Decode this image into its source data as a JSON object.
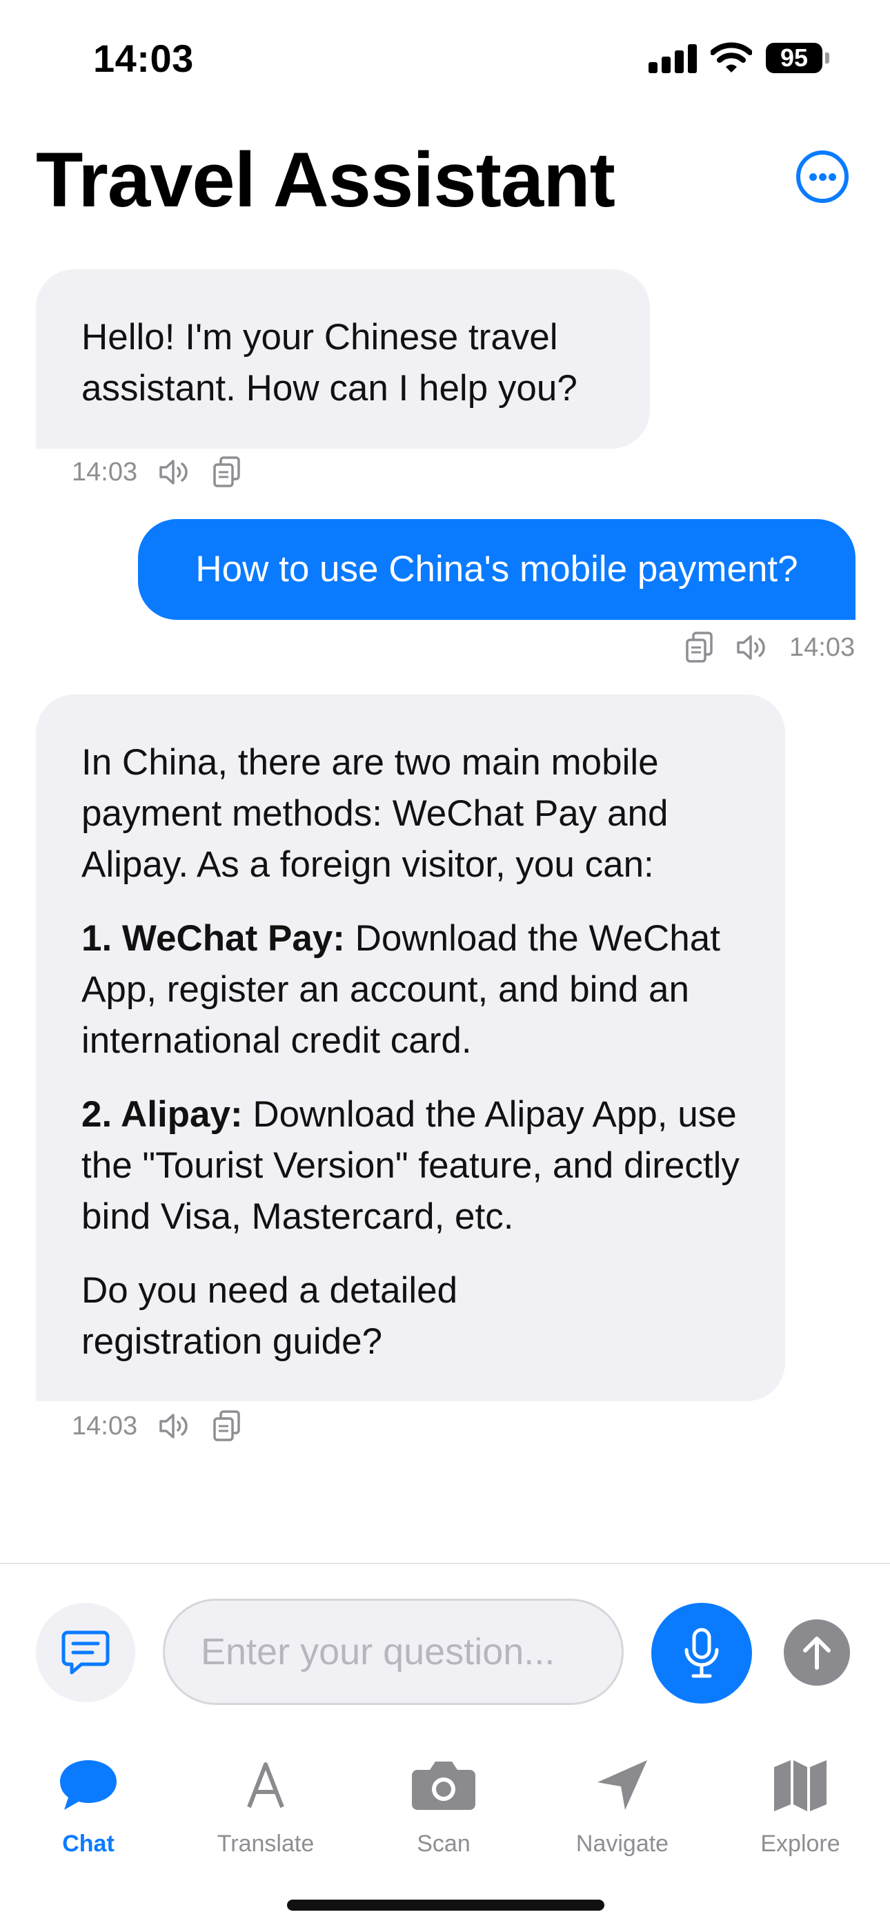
{
  "status_bar": {
    "time": "14:03",
    "battery": "95"
  },
  "header": {
    "title": "Travel Assistant",
    "more_icon": "ellipsis-circle-icon"
  },
  "messages": [
    {
      "role": "assistant",
      "paragraphs": [
        "Hello! I'm your Chinese travel assistant. How can I help you?"
      ],
      "time": "14:03"
    },
    {
      "role": "user",
      "text": "How to use China's mobile payment?",
      "time": "14:03"
    },
    {
      "role": "assistant",
      "intro": "In China, there are two main mobile payment methods: WeChat Pay and Alipay. As a foreign visitor, you can:",
      "items": [
        {
          "title": "1. WeChat Pay:",
          "text": "Download the WeChat App, register an account, and bind an international credit card."
        },
        {
          "title": "2. Alipay:",
          "text": "Download the Alipay App, use the \"Tourist Version\" feature, and directly bind Visa, Mastercard, etc."
        }
      ],
      "outro": "Do you need a detailed registration guide?",
      "time": "14:03"
    }
  ],
  "composer": {
    "placeholder": "Enter your question..."
  },
  "tabs": [
    {
      "label": "Chat",
      "icon": "chat-bubble-icon",
      "active": true
    },
    {
      "label": "Translate",
      "icon": "letter-a-icon",
      "active": false
    },
    {
      "label": "Scan",
      "icon": "camera-icon",
      "active": false
    },
    {
      "label": "Navigate",
      "icon": "location-arrow-icon",
      "active": false
    },
    {
      "label": "Explore",
      "icon": "map-icon",
      "active": false
    }
  ],
  "colors": {
    "accent": "#0a7bff",
    "bubble_ai": "#f1f1f5",
    "muted": "#8e8e93",
    "send_disabled": "#8a8a8f"
  }
}
